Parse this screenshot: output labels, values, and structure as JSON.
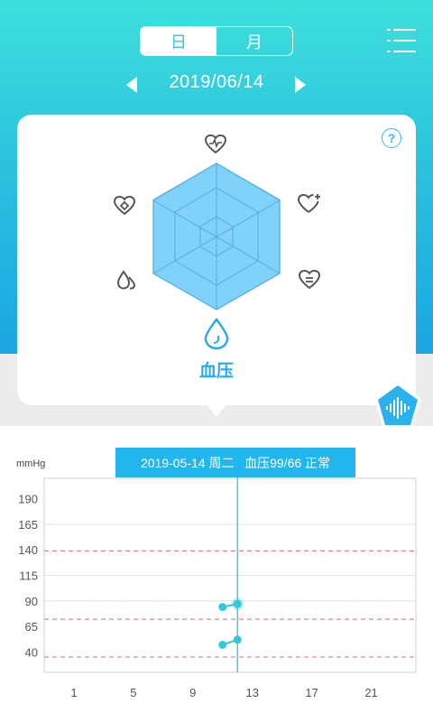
{
  "tabs": {
    "day": "日",
    "month": "月"
  },
  "date": {
    "current": "2019/06/14"
  },
  "card": {
    "help_label": "?",
    "selected_metric": "血压",
    "metric_icons": [
      "heart-rate-icon",
      "heart-plus-icon",
      "heart-equal-icon",
      "blood-drop-icon",
      "double-drop-icon",
      "heart-diamond-icon"
    ]
  },
  "chart": {
    "unit": "mmHg",
    "tooltip": "2019-05-14 周二   血压99/66 正常",
    "colors": {
      "accent": "#22b6ee",
      "point": "#31c9d8",
      "reference": "#e06666"
    }
  },
  "chart_data": {
    "type": "scatter",
    "y_ticks": [
      190,
      165,
      140,
      115,
      90,
      65,
      40
    ],
    "x_ticks": [
      1,
      5,
      9,
      13,
      17,
      21
    ],
    "ylim": [
      20,
      210
    ],
    "xlim": [
      -1,
      24
    ],
    "reference_lines": [
      139,
      72,
      35
    ],
    "cursor_x": 12,
    "series": [
      {
        "points": [
          [
            11,
            84
          ],
          [
            12,
            87
          ]
        ]
      },
      {
        "points": [
          [
            11,
            47
          ],
          [
            12,
            52
          ]
        ]
      }
    ]
  }
}
